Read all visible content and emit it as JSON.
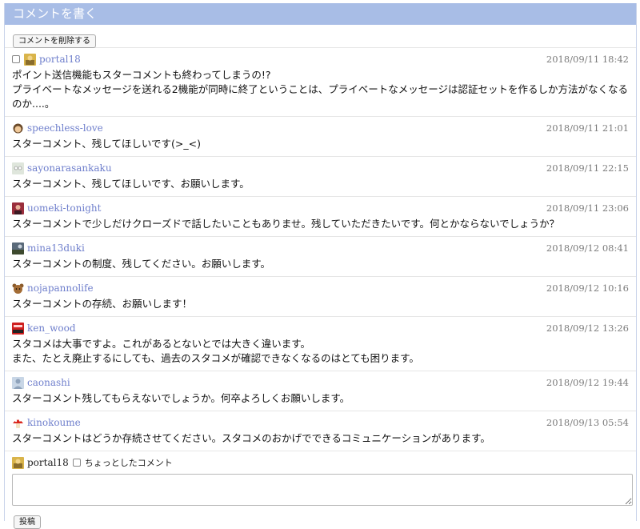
{
  "header": {
    "title": "コメントを書く"
  },
  "toolbar": {
    "delete_label": "コメントを削除する"
  },
  "comments": [
    {
      "user": "portal18",
      "date": "2018/09/11 18:42",
      "text": "ポイント送信機能もスターコメントも終わってしまうの!?\nプライベートなメッセージを送れる2機能が同時に終了ということは、プライベートなメッセージは認証セットを作るしか方法がなくなるのか....。",
      "icon": "portal18-avatar-icon",
      "has_checkbox": true
    },
    {
      "user": "speechless-love",
      "date": "2018/09/11 21:01",
      "text": "スターコメント、残してほしいです(>_<)",
      "icon": "speechless-love-avatar-icon"
    },
    {
      "user": "sayonarasankaku",
      "date": "2018/09/11 22:15",
      "text": "スターコメント、残してほしいです、お願いします。",
      "icon": "sayonarasankaku-avatar-icon"
    },
    {
      "user": "uomeki-tonight",
      "date": "2018/09/11 23:06",
      "text": "スターコメントで少しだけクローズドで話したいこともありませ。残していただきたいです。何とかならないでしょうか？",
      "icon": "uomeki-tonight-avatar-icon"
    },
    {
      "user": "mina13duki",
      "date": "2018/09/12 08:41",
      "text": "スターコメントの制度、残してください。お願いします。",
      "icon": "mina13duki-avatar-icon"
    },
    {
      "user": "nojapannolife",
      "date": "2018/09/12 10:16",
      "text": "スターコメントの存続、お願いします！",
      "icon": "nojapannolife-avatar-icon"
    },
    {
      "user": "ken_wood",
      "date": "2018/09/12 13:26",
      "text": "スタコメは大事ですよ。これがあるとないとでは大きく違います。\nまた、たとえ廃止するにしても、過去のスタコメが確認できなくなるのはとても困ります。",
      "icon": "ken_wood-avatar-icon"
    },
    {
      "user": "caonashi",
      "date": "2018/09/12 19:44",
      "text": "スターコメント残してもらえないでしょうか。何卒よろしくお願いします。",
      "icon": "caonashi-avatar-icon"
    },
    {
      "user": "kinokoume",
      "date": "2018/09/13 05:54",
      "text": "スターコメントはどうか存続させてください。スタコメのおかげでできるコミュニケーションがあります。",
      "icon": "kinokoume-avatar-icon"
    }
  ],
  "compose": {
    "user": "portal18",
    "checkbox_label": "ちょっとしたコメント",
    "textarea_value": "",
    "submit_label": "投稿"
  },
  "colors": {
    "header_bg": "#a8bde6",
    "link": "#6f7fcc",
    "date": "#7b7b7b"
  }
}
